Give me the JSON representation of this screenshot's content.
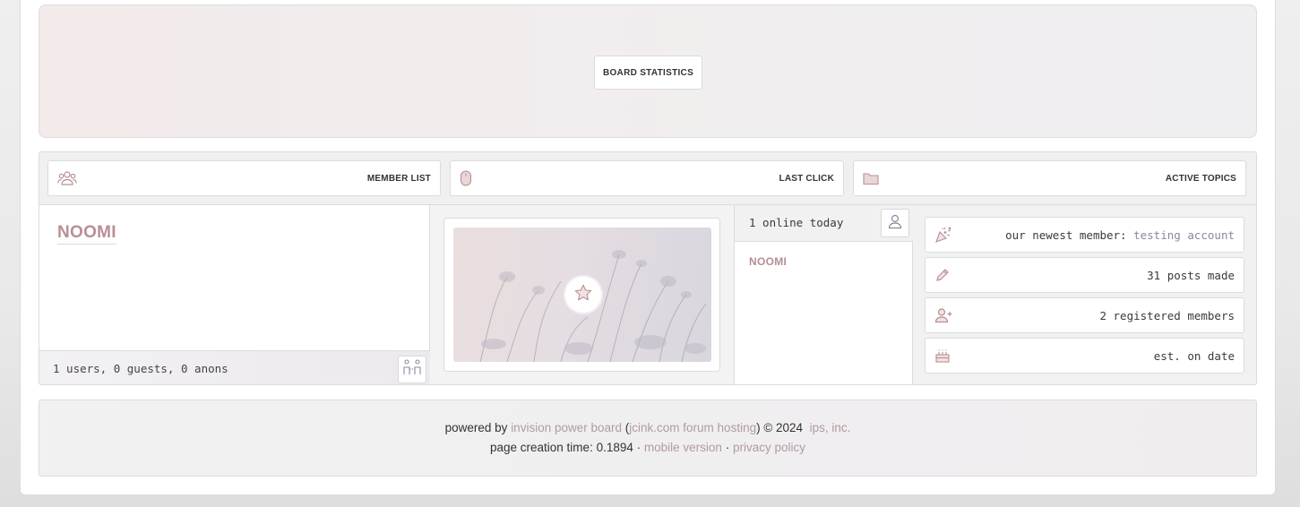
{
  "board_stats": {
    "label": "BOARD STATISTICS"
  },
  "nav": {
    "member_list": {
      "label": "MEMBER LIST",
      "icon": "group-icon"
    },
    "last_click": {
      "label": "LAST CLICK",
      "icon": "mouse-icon"
    },
    "active_topics": {
      "label": "ACTIVE TOPICS",
      "icon": "folder-icon"
    }
  },
  "online_users": {
    "featured_name": "NOOMI",
    "count_text": "1 users, 0 guests, 0 anons"
  },
  "online_today": {
    "heading": "1 online today",
    "users": [
      "NOOMI"
    ]
  },
  "stats": {
    "newest_member_prefix": "our newest member:",
    "newest_member_name": "testing account",
    "posts": "31 posts made",
    "registered": "2 registered members",
    "established": "est. on date"
  },
  "footer": {
    "powered_by": "powered by",
    "ipb_link": "invision power board",
    "open_paren": "(",
    "jcink_link": "jcink.com forum hosting",
    "close_copy": ") © 2024",
    "ips_link": "ips, inc.",
    "page_time": "page creation time: 0.1894 ·",
    "mobile_link": "mobile version",
    "sep": "·",
    "privacy_link": "privacy policy"
  },
  "colors": {
    "accent_name": "#b98f93",
    "link": "#b09aa1",
    "newest_member_link": "#8e86a3"
  }
}
